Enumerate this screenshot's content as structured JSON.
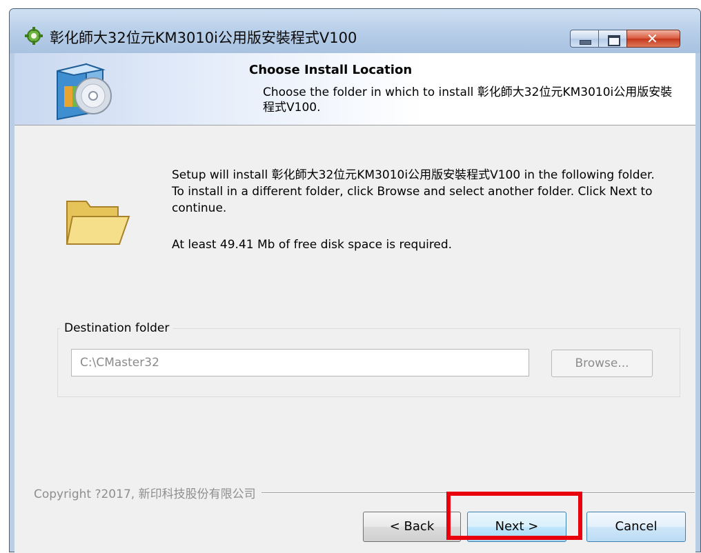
{
  "window": {
    "title": "彰化師大32位元KM3010i公用版安裝程式V100",
    "controls": {
      "minimize": "minimize-icon",
      "maximize": "maximize-icon",
      "close": "close-icon"
    }
  },
  "header": {
    "title": "Choose Install Location",
    "subtitle": "Choose the folder in which to install 彰化師大32位元KM3010i公用版安裝程式V100."
  },
  "body": {
    "intro": "Setup will install 彰化師大32位元KM3010i公用版安裝程式V100 in the following folder. To install in a different folder, click Browse and select another folder. Click Next to continue.",
    "space_required": "At least 49.41 Mb of free disk space is required."
  },
  "destination": {
    "group_label": "Destination folder",
    "path": "C:\\CMaster32",
    "browse_label": "Browse..."
  },
  "footer": {
    "copyright": "Copyright ?2017, 新印科技股份有限公司",
    "back_label": "< Back",
    "next_label": "Next >",
    "cancel_label": "Cancel"
  },
  "colors": {
    "highlight": "#e8000d",
    "title_bar": "#b6cde8",
    "close_button": "#c3361c"
  }
}
